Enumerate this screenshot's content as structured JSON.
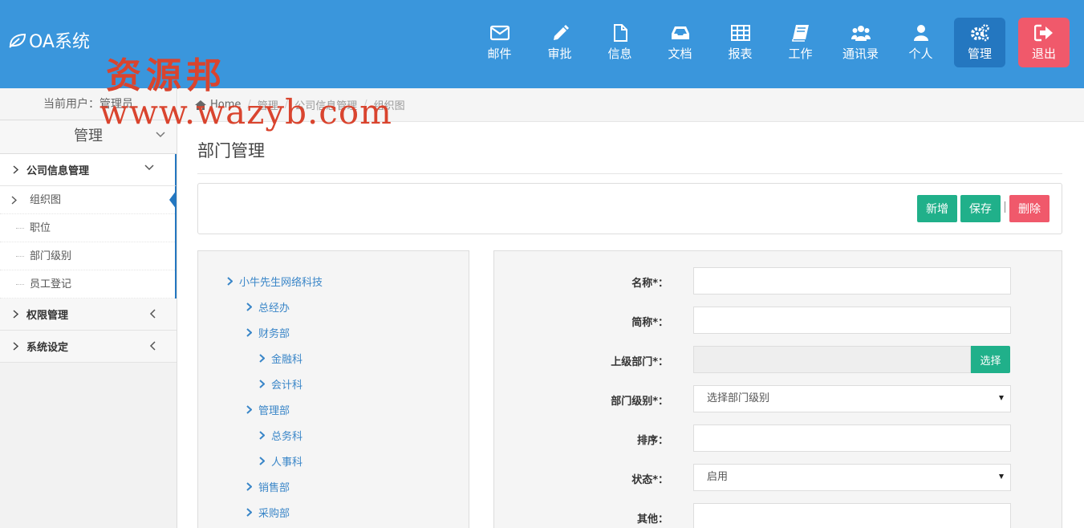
{
  "header": {
    "logo_text": "OA系统",
    "nav": [
      {
        "label": "邮件",
        "icon": "envelope-icon"
      },
      {
        "label": "审批",
        "icon": "pencil-icon"
      },
      {
        "label": "信息",
        "icon": "file-icon"
      },
      {
        "label": "文档",
        "icon": "inbox-icon"
      },
      {
        "label": "报表",
        "icon": "table-icon"
      },
      {
        "label": "工作",
        "icon": "book-icon"
      },
      {
        "label": "通讯录",
        "icon": "users-icon"
      },
      {
        "label": "个人",
        "icon": "user-icon"
      },
      {
        "label": "管理",
        "icon": "gears-icon"
      },
      {
        "label": "退出",
        "icon": "sign-out-icon"
      }
    ],
    "colors": {
      "bar": "#3a96dc",
      "active": "#2477c0",
      "logout": "#f0596b"
    }
  },
  "watermark": {
    "text_cn": "资源邦",
    "url": "www.wazyb.com"
  },
  "sidebar": {
    "current_user": "当前用户：管理员",
    "title": "管理",
    "groups": [
      {
        "label": "公司信息管理",
        "items": [
          "组织图",
          "职位",
          "部门级别",
          "员工登记"
        ]
      },
      {
        "label": "权限管理"
      },
      {
        "label": "系统设定"
      }
    ]
  },
  "breadcrumb": {
    "home": "Home",
    "items": [
      "管理",
      "公司信息管理",
      "组织图"
    ],
    "separator": "/"
  },
  "page": {
    "title": "部门管理"
  },
  "toolbar": {
    "add": "新增",
    "save": "保存",
    "divider": "|",
    "delete": "删除"
  },
  "tree": {
    "root": "小牛先生网络科技",
    "nodes": [
      "总经办",
      "财务部",
      "金融科",
      "会计科",
      "管理部",
      "总务科",
      "人事科",
      "销售部",
      "采购部"
    ]
  },
  "form": {
    "name_label": "名称*：",
    "short_label": "简称*：",
    "parent_label": "上级部门*：",
    "select_btn": "选择",
    "level_label": "部门级别*：",
    "level_value": "选择部门级别",
    "order_label": "排序：",
    "status_label": "状态*：",
    "status_value": "启用",
    "other_label": "其他："
  }
}
